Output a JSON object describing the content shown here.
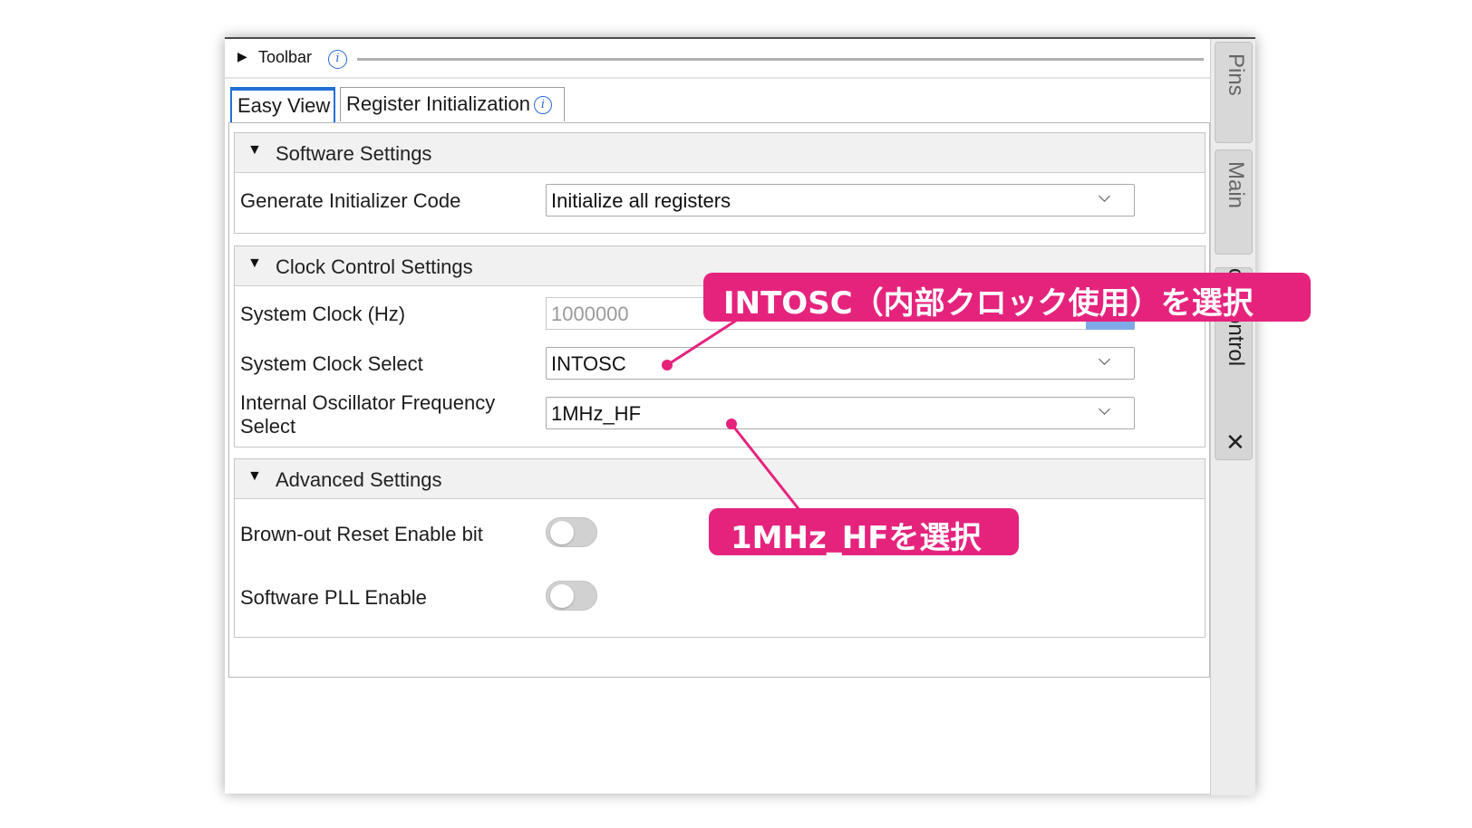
{
  "toolbar": {
    "label": "Toolbar",
    "info_icon": "info-icon"
  },
  "tabs": [
    {
      "label": "Easy View",
      "active": true
    },
    {
      "label": "Register Initialization",
      "info_icon": "info-icon"
    }
  ],
  "sections": {
    "software": {
      "title": "Software Settings",
      "rows": [
        {
          "label": "Generate Initializer Code",
          "value": "Initialize all registers"
        }
      ]
    },
    "clock": {
      "title": "Clock Control Settings",
      "rows": [
        {
          "label": "System Clock (Hz)",
          "value": "1000000"
        },
        {
          "label": "System Clock Select",
          "value": "INTOSC"
        },
        {
          "label": "Internal Oscillator Frequency Select",
          "value": "1MHz_HF"
        }
      ]
    },
    "advanced": {
      "title": "Advanced Settings",
      "rows": [
        {
          "label": "Brown-out Reset Enable bit",
          "enabled": false
        },
        {
          "label": "Software PLL Enable",
          "enabled": false
        }
      ]
    }
  },
  "sidebar": {
    "tabs": [
      {
        "label": "Pins"
      },
      {
        "label": "Main"
      },
      {
        "label": "Clock Control",
        "visible_text": "ck Control"
      }
    ],
    "close_glyph": "✕"
  },
  "annotations": {
    "intosc": "INTOSC（内部クロック使用）を選択",
    "mhz": "1MHz_HFを選択",
    "color": "#e5237d"
  },
  "colors": {
    "accent": "#2170d6",
    "callout": "#e5237d",
    "spinner": "#7faae8"
  }
}
